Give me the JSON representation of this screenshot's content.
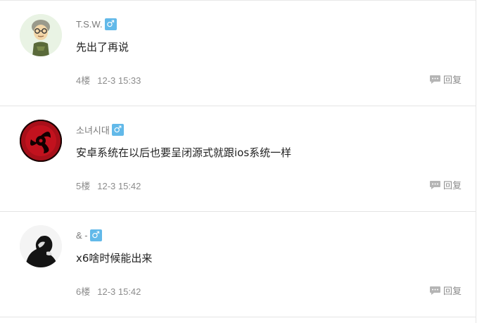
{
  "posts": [
    {
      "username": "T.S.W.",
      "gender_icon": "male-icon",
      "gender_symbol": "♂",
      "content": "先出了再说",
      "floor": "4楼",
      "time": "12-3 15:33",
      "reply_label": "回复"
    },
    {
      "username": "소녀시대",
      "gender_icon": "male-icon",
      "gender_symbol": "♂",
      "content": "安卓系统在以后也要呈闭源式就跟ios系统一样",
      "floor": "5楼",
      "time": "12-3 15:42",
      "reply_label": "回复"
    },
    {
      "username": "& -",
      "gender_icon": "male-icon",
      "gender_symbol": "♂",
      "content": "x6啥时候能出来",
      "floor": "6楼",
      "time": "12-3 15:42",
      "reply_label": "回复"
    }
  ],
  "colors": {
    "gender_badge": "#62b9e9",
    "meta_text": "#8c8c8c",
    "divider": "#e4e4e4"
  }
}
